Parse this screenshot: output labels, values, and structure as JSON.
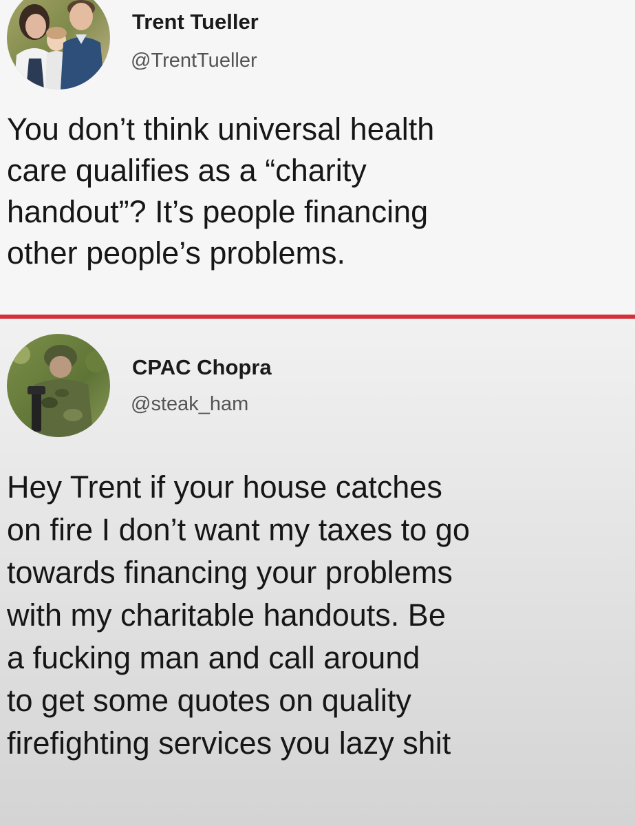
{
  "tweets": [
    {
      "author": {
        "display_name": "Trent Tueller",
        "handle": "@TrentTueller",
        "avatar": "family-photo-avatar"
      },
      "text_lines": [
        "You don’t think universal health",
        "care qualifies as a “charity",
        "handout”? It’s people financing",
        "other people’s problems."
      ]
    },
    {
      "author": {
        "display_name": "CPAC Chopra",
        "handle": "@steak_ham",
        "avatar": "soldier-photo-avatar"
      },
      "text_lines": [
        "Hey Trent if your house catches",
        "on fire I don’t want my taxes to go",
        "towards financing your problems",
        "with my charitable handouts. Be",
        "a fucking man and call around",
        "to get some quotes on quality",
        "firefighting services you lazy shit"
      ]
    }
  ],
  "colors": {
    "divider": "#d3303a",
    "text": "#161616",
    "handle": "#545454"
  }
}
